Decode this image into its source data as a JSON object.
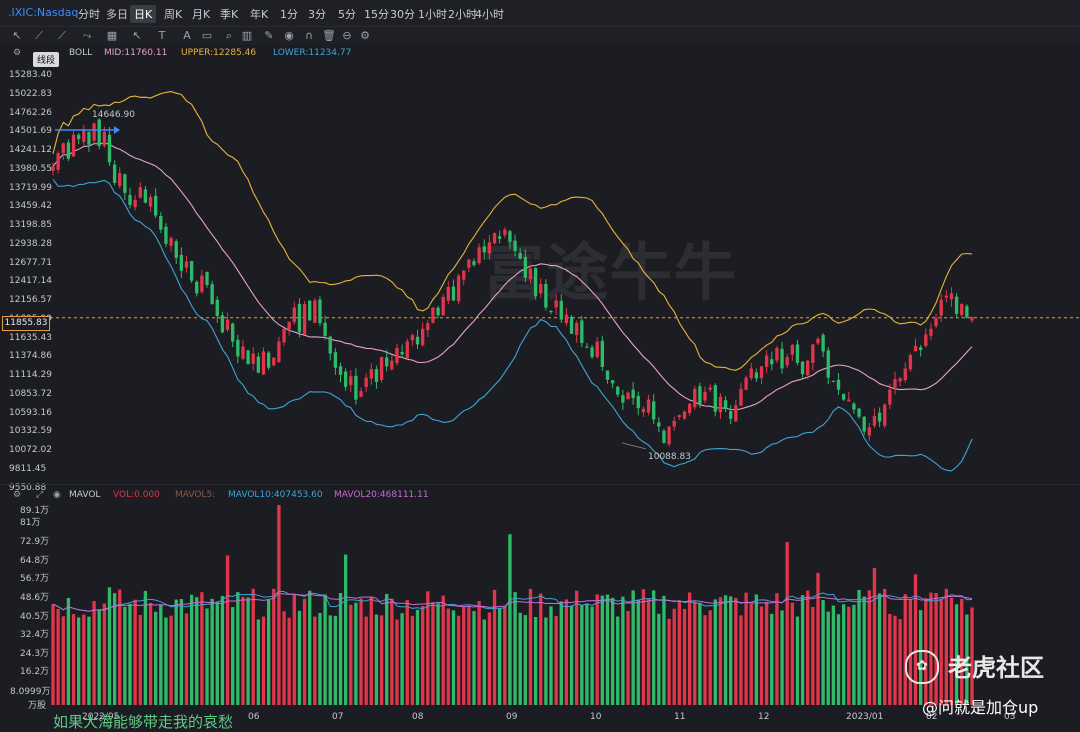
{
  "header": {
    "symbol": ".IXIC:Nasdaq",
    "timeframes": [
      "分时",
      "多日",
      "日K",
      "周K",
      "月K",
      "季K",
      "年K",
      "1分",
      "3分",
      "5分",
      "15分",
      "30分",
      "1小时",
      "2小时",
      "4小时"
    ],
    "selected": "日K"
  },
  "toolbar_tooltip": "线段",
  "indicator": {
    "name": "BOLL",
    "mid": "MID:11760.11",
    "upper": "UPPER:12285.46",
    "lower": "LOWER:11234.77"
  },
  "volume_indicator": {
    "name": "MAVOL",
    "vol": "VOL:0.000",
    "mavol5": "MAVOL5:",
    "mavol10": "MAVOL10:407453.60",
    "mavol20": "MAVOL20:468111.11"
  },
  "price_axis": [
    "15283.40",
    "15022.83",
    "14762.26",
    "14501.69",
    "14241.12",
    "13980.55",
    "13719.99",
    "13459.42",
    "13198.85",
    "12938.28",
    "12677.71",
    "12417.14",
    "12156.57",
    "11895.99",
    "11635.43",
    "11374.86",
    "11114.29",
    "10853.72",
    "10593.16",
    "10332.59",
    "10072.02",
    "9811.45",
    "9550.88"
  ],
  "current_price": "11855.83",
  "high_label": "14646.90",
  "low_label": "10088.83",
  "volume_axis": [
    "89.1万",
    "81万",
    "72.9万",
    "64.8万",
    "56.7万",
    "48.6万",
    "40.5万",
    "32.4万",
    "24.3万",
    "16.2万",
    "8.0999万",
    "万股"
  ],
  "x_labels": [
    "2022/05",
    "06",
    "07",
    "08",
    "09",
    "10",
    "11",
    "12",
    "2023/01",
    "02",
    "03"
  ],
  "watermark": "富途牛牛",
  "community": "老虎社区",
  "community_user": "@问就是加仓up",
  "caption": "如果大海能够带走我的哀愁",
  "colors": {
    "up": "#e0354a",
    "down": "#2fba6a",
    "upper_band": "#e7b43a",
    "mid_band": "#e7a2c6",
    "lower_band": "#3fa3d6",
    "mavol10": "#3fa3d6",
    "mavol20": "#c86ad6"
  },
  "chart_data": [
    {
      "type": "candlestick",
      "indicator": "BOLL",
      "ylim": [
        9550.88,
        15283.4
      ],
      "x_months": [
        "2022/05",
        "06",
        "07",
        "08",
        "09",
        "10",
        "11",
        "12",
        "2023/01",
        "02",
        "03"
      ],
      "annotations": {
        "high": 14646.9,
        "low": 10088.83,
        "current": 11855.83
      },
      "close": [
        13990,
        14180,
        14320,
        14100,
        14440,
        14380,
        14520,
        14300,
        14600,
        14280,
        14480,
        14050,
        13760,
        13900,
        13620,
        13450,
        13520,
        13700,
        13480,
        13560,
        13300,
        13100,
        12900,
        12980,
        12700,
        12520,
        12650,
        12380,
        12200,
        12450,
        12320,
        12050,
        11880,
        11650,
        11830,
        11520,
        11310,
        11450,
        11200,
        11350,
        11080,
        11380,
        11150,
        11290,
        11520,
        11700,
        11800,
        12000,
        11650,
        12050,
        11820,
        12100,
        11780,
        11600,
        11350,
        11150,
        11050,
        10880,
        11030,
        10700,
        10820,
        11010,
        11130,
        10950,
        11300,
        11170,
        11250,
        11430,
        11340,
        11520,
        11610,
        11480,
        11700,
        11780,
        12000,
        11890,
        12150,
        12290,
        12100,
        12450,
        12520,
        12680,
        12600,
        12850,
        12780,
        12920,
        13050,
        12970,
        13100,
        12930,
        12800,
        12690,
        12420,
        12550,
        12160,
        12330,
        12000,
        11950,
        12100,
        11830,
        11900,
        11630,
        11780,
        11500,
        11440,
        11300,
        11520,
        11160,
        10980,
        10930,
        10770,
        10660,
        10800,
        10720,
        10580,
        10570,
        10700,
        10420,
        10320,
        10090,
        10320,
        10400,
        10480,
        10530,
        10640,
        10850,
        10640,
        10810,
        10870,
        10530,
        10740,
        10570,
        10430,
        10620,
        10850,
        11010,
        11140,
        11000,
        11170,
        11320,
        11200,
        11430,
        11140,
        11300,
        11470,
        11220,
        11060,
        11250,
        11480,
        11560,
        11380,
        11010,
        10950,
        10840,
        10700,
        10700,
        10560,
        10460,
        10250,
        10310,
        10470,
        10390,
        10630,
        10840,
        10990,
        11000,
        11140,
        11330,
        11460,
        11400,
        11620,
        11700,
        11850,
        12110,
        12170,
        12200,
        11910,
        12050,
        11860,
        11860
      ],
      "mavol10_last": 407453.6,
      "mavol20_last": 468111.11,
      "volume_unit": "万股"
    }
  ]
}
